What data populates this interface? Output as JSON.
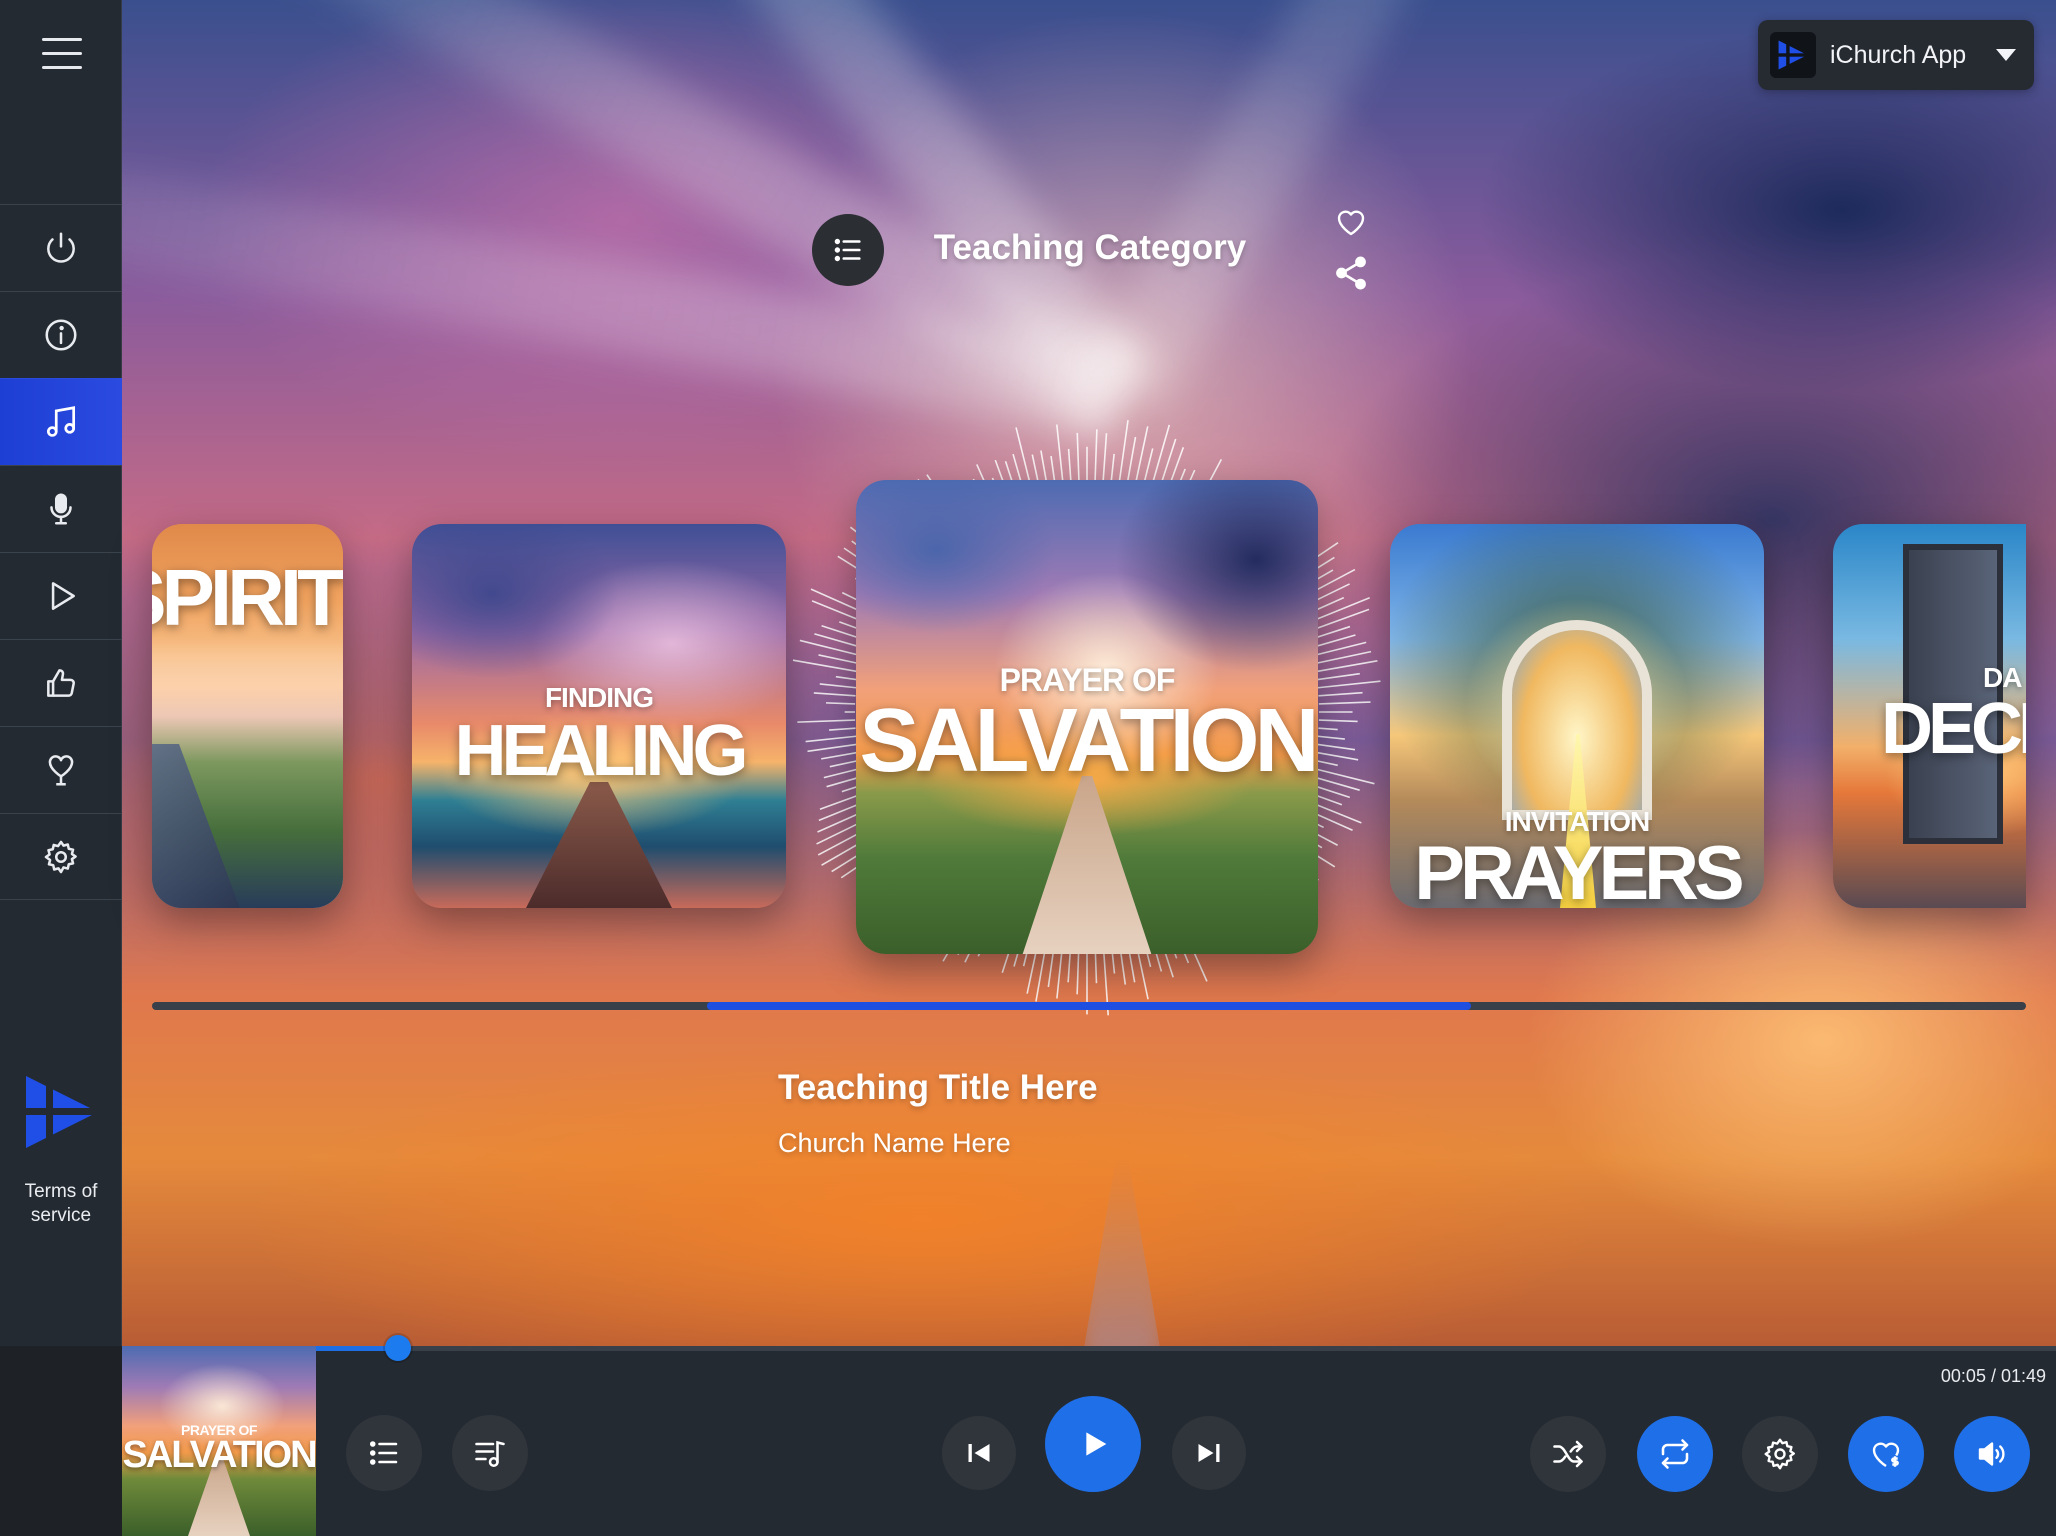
{
  "app_switcher": {
    "name": "iChurch App"
  },
  "header": {
    "category_title": "Teaching Category"
  },
  "sidebar": {
    "items": [
      {
        "name": "power",
        "icon": "power-icon"
      },
      {
        "name": "info",
        "icon": "info-icon"
      },
      {
        "name": "music",
        "icon": "music-note-icon",
        "active": true
      },
      {
        "name": "microphone",
        "icon": "microphone-icon"
      },
      {
        "name": "video",
        "icon": "play-icon"
      },
      {
        "name": "likes",
        "icon": "thumbs-up-icon"
      },
      {
        "name": "giving",
        "icon": "heart-hand-icon"
      },
      {
        "name": "settings",
        "icon": "gear-icon"
      }
    ],
    "terms_label": "Terms of service"
  },
  "carousel": {
    "cards": [
      {
        "id": "spirit",
        "kicker": "",
        "title": "SPIRIT"
      },
      {
        "id": "healing",
        "kicker": "FINDING",
        "title": "HEALING"
      },
      {
        "id": "salvation",
        "kicker": "PRAYER OF",
        "title": "SALVATION",
        "active": true
      },
      {
        "id": "prayers",
        "kicker": "INVITATION",
        "title": "PRAYERS"
      },
      {
        "id": "decision",
        "kicker": "DA",
        "title": "DECI"
      }
    ]
  },
  "now_playing": {
    "title": "Teaching Title Here",
    "church": "Church Name Here",
    "art_kicker": "PRAYER OF",
    "art_title": "SALVATION",
    "elapsed": "00:05",
    "duration": "01:49",
    "time_display": "00:05 / 01:49",
    "progress_fraction": 0.047
  },
  "colors": {
    "accent_blue": "#1f6fe8",
    "active_nav": "#1e3fd4",
    "panel": "#242a31"
  }
}
